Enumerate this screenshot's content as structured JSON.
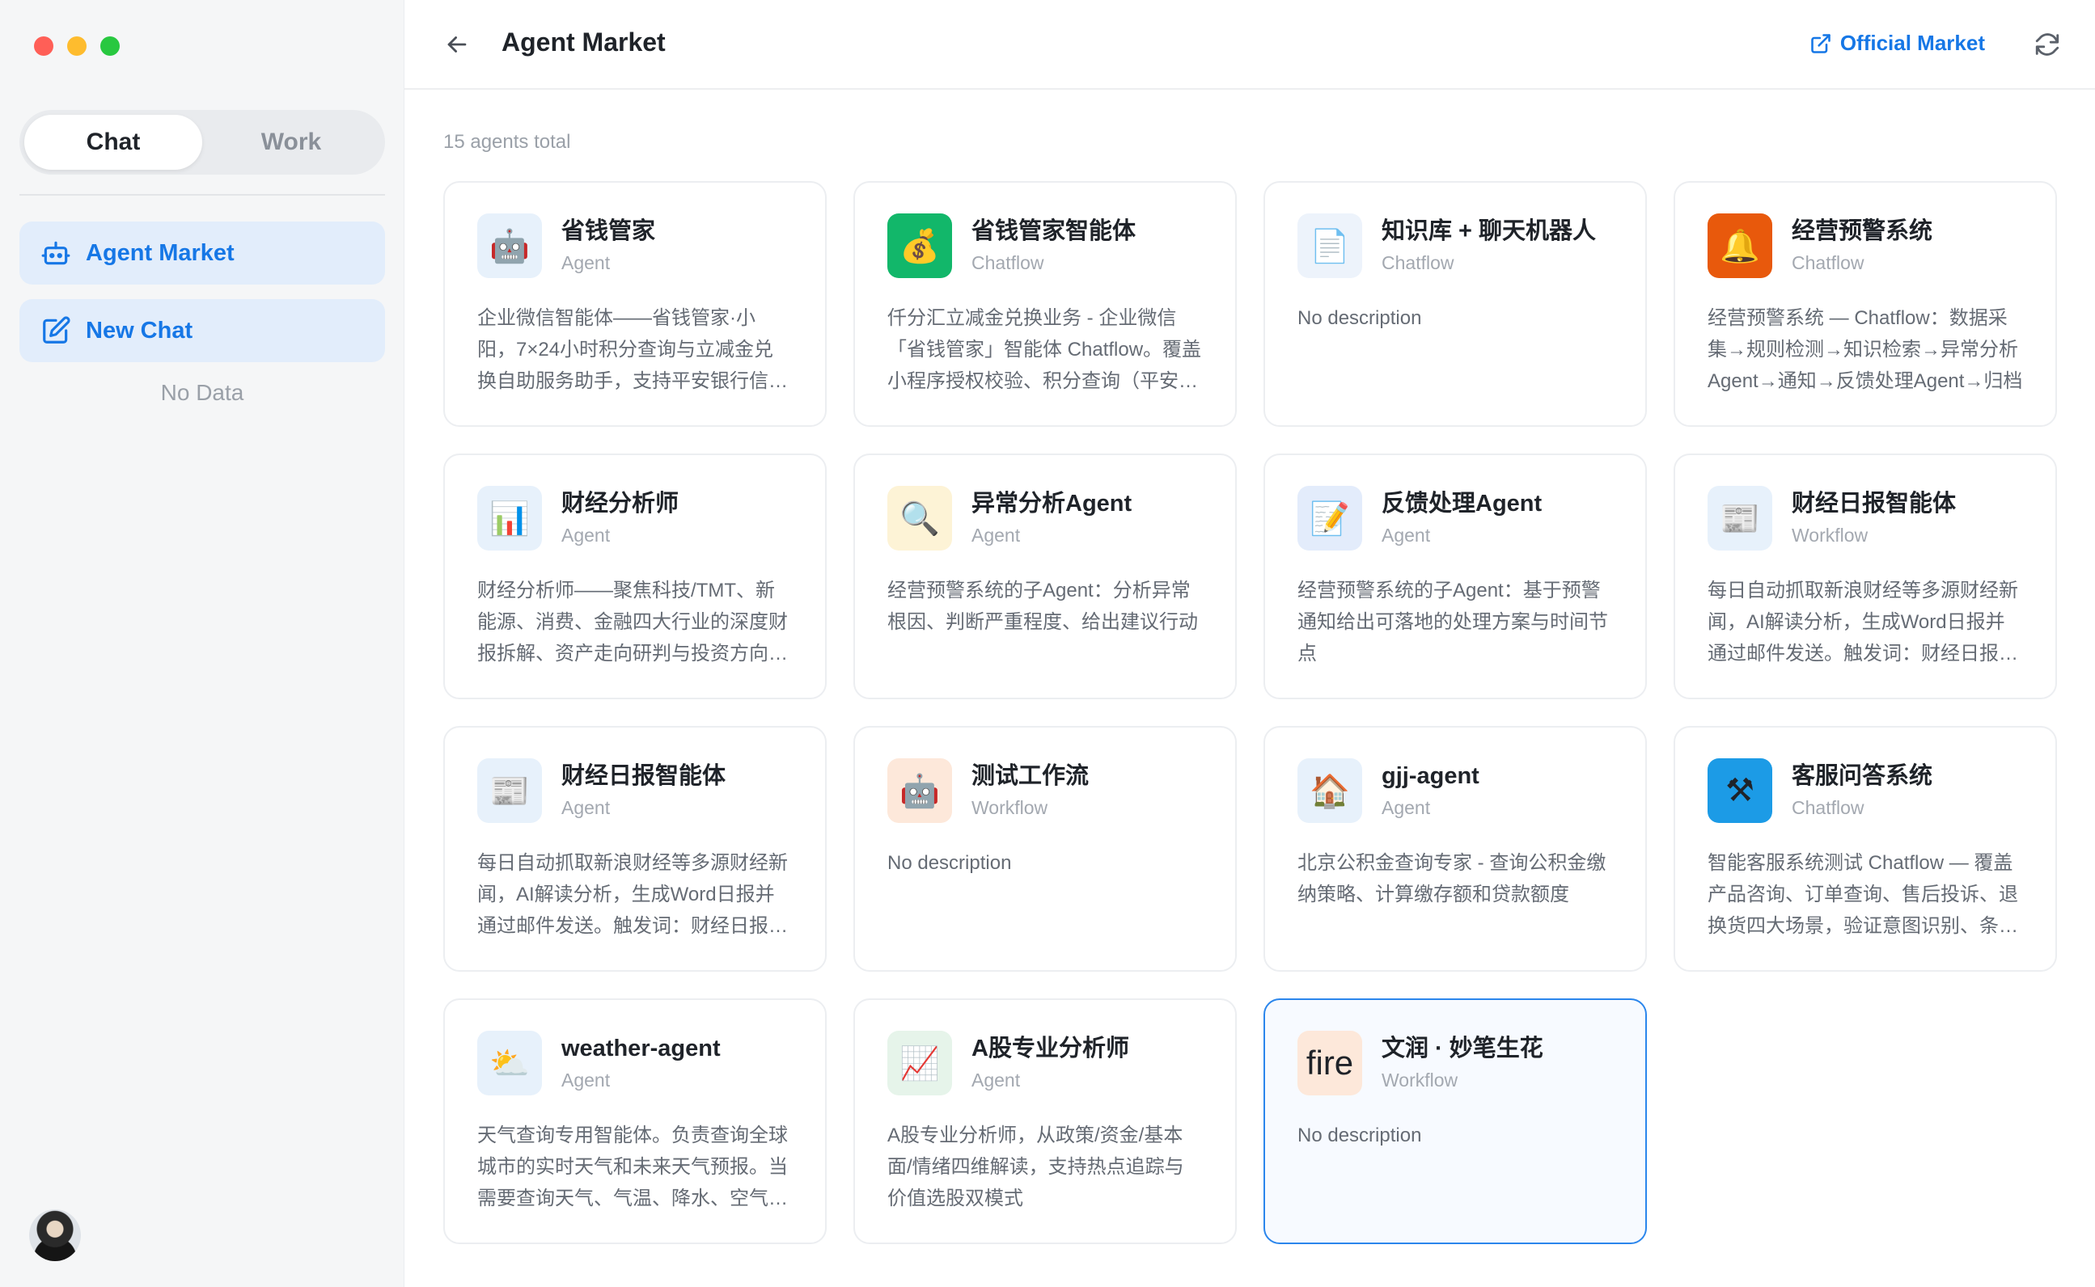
{
  "sidebar": {
    "mode_tabs": [
      {
        "label": "Chat",
        "active": true
      },
      {
        "label": "Work",
        "active": false
      }
    ],
    "nav": {
      "agent_market": "Agent Market",
      "new_chat": "New Chat"
    },
    "empty_text": "No Data"
  },
  "header": {
    "title": "Agent Market",
    "official_link": "Official Market"
  },
  "main": {
    "total_text": "15 agents total",
    "agents": [
      {
        "name": "省钱管家",
        "type": "Agent",
        "icon": "🤖",
        "icon_bg": "#e7f1fb",
        "description": "企业微信智能体——省钱管家·小阳，7×24小时积分查询与立减金兑换自助服务助手，支持平安银行信用卡积分查询、立减金兑换等业务"
      },
      {
        "name": "省钱管家智能体",
        "type": "Chatflow",
        "icon": "💰",
        "icon_bg": "#12b76a",
        "description": "仟分汇立减金兑换业务 - 企业微信「省钱管家」智能体 Chatflow。覆盖小程序授权校验、积分查询（平安银行）等"
      },
      {
        "name": "知识库 + 聊天机器人",
        "type": "Chatflow",
        "icon": "📄",
        "icon_bg": "#edf3fb",
        "description": "No description"
      },
      {
        "name": "经营预警系统",
        "type": "Chatflow",
        "icon": "🔔",
        "icon_bg": "#e8590c",
        "description": "经营预警系统 — Chatflow：数据采集→规则检测→知识检索→异常分析Agent→通知→反馈处理Agent→归档"
      },
      {
        "name": "财经分析师",
        "type": "Agent",
        "icon": "📊",
        "icon_bg": "#e7f1fb",
        "description": "财经分析师——聚焦科技/TMT、新能源、消费、金融四大行业的深度财报拆解、资产走向研判与投资方向总结"
      },
      {
        "name": "异常分析Agent",
        "type": "Agent",
        "icon": "🔍",
        "icon_bg": "#fdf3d6",
        "description": "经营预警系统的子Agent：分析异常根因、判断严重程度、给出建议行动"
      },
      {
        "name": "反馈处理Agent",
        "type": "Agent",
        "icon": "📝",
        "icon_bg": "#e3ecfb",
        "description": "经营预警系统的子Agent：基于预警通知给出可落地的处理方案与时间节点"
      },
      {
        "name": "财经日报智能体",
        "type": "Workflow",
        "icon": "📰",
        "icon_bg": "#e7f1fb",
        "description": "每日自动抓取新浪财经等多源财经新闻，AI解读分析，生成Word日报并通过邮件发送。触发词：财经日报、今日财经"
      },
      {
        "name": "财经日报智能体",
        "type": "Agent",
        "icon": "📰",
        "icon_bg": "#e7f1fb",
        "description": "每日自动抓取新浪财经等多源财经新闻，AI解读分析，生成Word日报并通过邮件发送。触发词：财经日报、今日财经"
      },
      {
        "name": "测试工作流",
        "type": "Workflow",
        "icon": "🤖",
        "icon_bg": "#fde8da",
        "description": "No description"
      },
      {
        "name": "gjj-agent",
        "type": "Agent",
        "icon": "🏠",
        "icon_bg": "#e7f1fb",
        "description": "北京公积金查询专家 - 查询公积金缴纳策略、计算缴存额和贷款额度"
      },
      {
        "name": "客服问答系统",
        "type": "Chatflow",
        "icon": "⚒",
        "icon_bg": "#1c9be6",
        "description": "智能客服系统测试 Chatflow — 覆盖产品咨询、订单查询、售后投诉、退换货四大场景，验证意图识别、条件分支等能力"
      },
      {
        "name": "weather-agent",
        "type": "Agent",
        "icon": "⛅",
        "icon_bg": "#e7f1fb",
        "description": "天气查询专用智能体。负责查询全球城市的实时天气和未来天气预报。当需要查询天气、气温、降水、空气质量时调用"
      },
      {
        "name": "A股专业分析师",
        "type": "Agent",
        "icon": "📈",
        "icon_bg": "#e6f4ea",
        "description": "A股专业分析师，从政策/资金/基本面/情绪四维解读，支持热点追踪与价值选股双模式"
      },
      {
        "name": "文润 · 妙笔生花",
        "type": "Workflow",
        "icon": "fire",
        "icon_bg": "#fde8da",
        "text_icon": true,
        "selected": true,
        "description": "No description"
      }
    ]
  }
}
